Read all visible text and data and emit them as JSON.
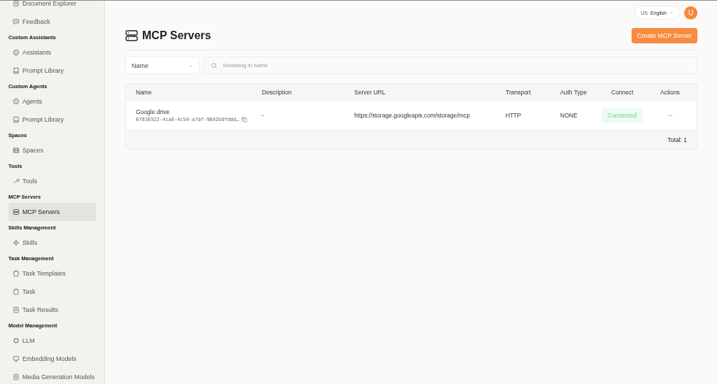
{
  "sidebar": {
    "sections": [
      {
        "items": [
          {
            "label": "Document Explorer",
            "selected": false
          },
          {
            "label": "Feedback",
            "selected": false
          }
        ]
      },
      {
        "label": "Custom Assistants",
        "items": [
          {
            "label": "Assistants",
            "selected": false
          },
          {
            "label": "Prompt Library",
            "selected": false
          }
        ]
      },
      {
        "label": "Custom Agents",
        "items": [
          {
            "label": "Agents",
            "selected": false
          },
          {
            "label": "Prompt Library",
            "selected": false
          }
        ]
      },
      {
        "label": "Spaces",
        "items": [
          {
            "label": "Spaces",
            "selected": false
          }
        ]
      },
      {
        "label": "Tools",
        "items": [
          {
            "label": "Tools",
            "selected": false
          }
        ]
      },
      {
        "label": "MCP Servers",
        "items": [
          {
            "label": "MCP Servers",
            "selected": true
          }
        ]
      },
      {
        "label": "Skills Management",
        "items": [
          {
            "label": "Skills",
            "selected": false
          }
        ]
      },
      {
        "label": "Task Management",
        "items": [
          {
            "label": "Task Templates",
            "selected": false
          },
          {
            "label": "Task",
            "selected": false
          },
          {
            "label": "Task Results",
            "selected": false
          }
        ]
      },
      {
        "label": "Model Management",
        "items": [
          {
            "label": "LLM",
            "selected": false
          },
          {
            "label": "Embedding Models",
            "selected": false
          },
          {
            "label": "Media Generation Models",
            "selected": false
          }
        ]
      }
    ]
  },
  "header": {
    "language_code": "US",
    "language": "English",
    "avatar": "U"
  },
  "page": {
    "title": "MCP Servers",
    "create_button": "Create MCP Server"
  },
  "filter": {
    "field": "Name",
    "placeholder": "Substring in name"
  },
  "table": {
    "columns": [
      "Name",
      "Description",
      "Server URL",
      "Transport",
      "Auth Type",
      "Connect",
      "Actions"
    ],
    "rows": [
      {
        "name": "Google drive",
        "id": "67816322-4ca8-4c54-a7df-9842bdfddd…",
        "description": "-",
        "url": "https://storage.googleapis.com/storage/mcp",
        "transport": "HTTP",
        "auth": "NONE",
        "connect": "Connected",
        "actions": "···"
      }
    ],
    "total": "Total: 1"
  }
}
